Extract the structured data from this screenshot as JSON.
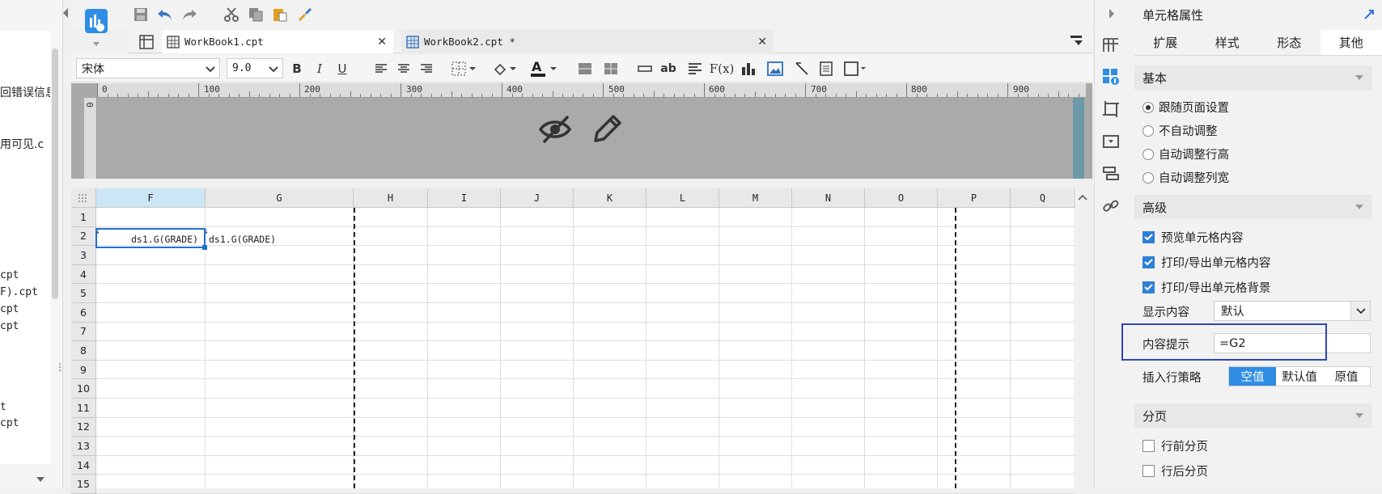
{
  "left_panel": {
    "lines": [
      {
        "text": "回错误信息",
        "cjk": true
      },
      {
        "text": "用可见.c",
        "cjk": true
      },
      {
        "text": "cpt",
        "cjk": false
      },
      {
        "text": "F).cpt",
        "cjk": false
      },
      {
        "text": "cpt",
        "cjk": false
      },
      {
        "text": "cpt",
        "cjk": false
      },
      {
        "text": "t",
        "cjk": false
      },
      {
        "text": "cpt",
        "cjk": false
      }
    ]
  },
  "tabs": [
    {
      "label": "WorkBook1.cpt",
      "close": "✕"
    },
    {
      "label": "WorkBook2.cpt *",
      "close": "✕"
    }
  ],
  "format_bar": {
    "font_name": "宋体",
    "font_size": "9.0",
    "bold": "B",
    "italic": "I",
    "underline": "U",
    "abc": "ab",
    "formula": "F(x)"
  },
  "ruler": {
    "marks": [
      "0",
      "100",
      "200",
      "300",
      "400",
      "500",
      "600",
      "700",
      "800",
      "900"
    ],
    "vertical_zero": "0"
  },
  "sheet": {
    "columns": [
      "F",
      "G",
      "H",
      "I",
      "J",
      "K",
      "L",
      "M",
      "N",
      "O",
      "P",
      "Q"
    ],
    "rows": [
      "1",
      "2",
      "3",
      "4",
      "5",
      "6",
      "7",
      "8",
      "9",
      "10",
      "11",
      "12",
      "13",
      "14",
      "15"
    ],
    "cells": {
      "F2": "ds1.G(GRADE)",
      "G2": "ds1.G(GRADE)"
    },
    "selected_column": "F",
    "selected_cell": "F2"
  },
  "properties": {
    "title": "单元格属性",
    "tabs": [
      "扩展",
      "样式",
      "形态",
      "其他"
    ],
    "active_tab": "其他",
    "basic": {
      "header": "基本",
      "options": [
        "跟随页面设置",
        "不自动调整",
        "自动调整行高",
        "自动调整列宽"
      ],
      "selected": "跟随页面设置"
    },
    "advanced": {
      "header": "高级",
      "checkboxes": [
        "预览单元格内容",
        "打印/导出单元格内容",
        "打印/导出单元格背景"
      ],
      "display_label": "显示内容",
      "display_value": "默认",
      "tooltip_label": "内容提示",
      "tooltip_value": "=G2",
      "policy_label": "插入行策略",
      "policy_options": [
        "空值",
        "默认值",
        "原值"
      ],
      "policy_selected": "空值"
    },
    "paging": {
      "header": "分页",
      "checkboxes": [
        "行前分页",
        "行后分页"
      ]
    }
  },
  "colors": {
    "accent_blue": "#2f8de4",
    "selection_blue": "#1f6fd6",
    "highlight_box": "#2f46b5",
    "header_teal": "#6b9aa8"
  }
}
